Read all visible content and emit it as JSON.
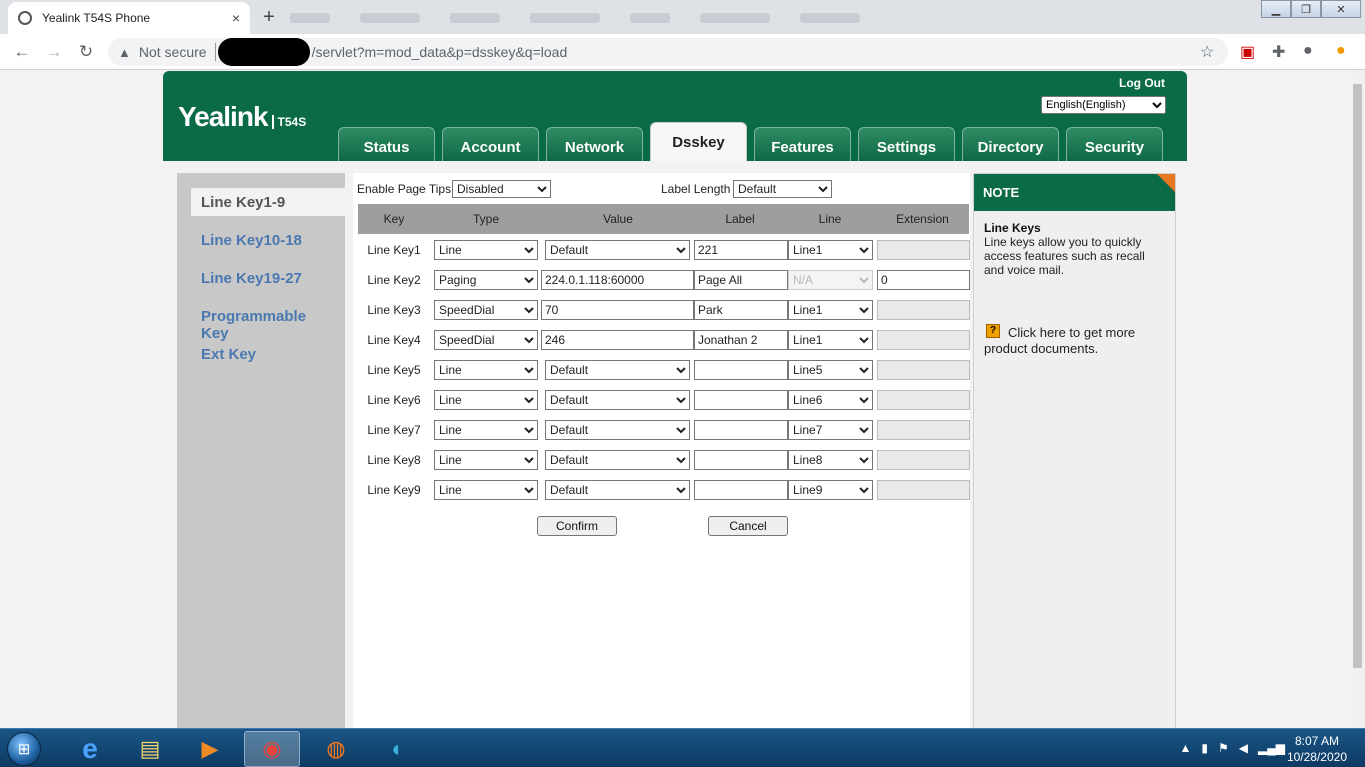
{
  "browser": {
    "tab_title": "Yealink T54S Phone",
    "tab_close": "×",
    "new_tab": "+",
    "security_label": "Not secure",
    "url_path": "/servlet?m=mod_data&p=dsskey&q=load"
  },
  "header": {
    "brand": "Yealink",
    "model": "T54S",
    "logout": "Log Out",
    "language": "English(English)",
    "nav_tabs": [
      "Status",
      "Account",
      "Network",
      "Dsskey",
      "Features",
      "Settings",
      "Directory",
      "Security"
    ],
    "active_tab": "Dsskey"
  },
  "sidebar": {
    "items": [
      "Line Key1-9",
      "Line Key10-18",
      "Line Key19-27",
      "Programmable Key",
      "Ext Key"
    ],
    "active": "Line Key1-9"
  },
  "controls": {
    "page_tips_label": "Enable Page Tips",
    "page_tips_value": "Disabled",
    "label_length_label": "Label Length",
    "label_length_value": "Default"
  },
  "table": {
    "headers": [
      "Key",
      "Type",
      "Value",
      "Label",
      "Line",
      "Extension"
    ],
    "rows": [
      {
        "key": "Line Key1",
        "type": "Line",
        "value": "Default",
        "value_kind": "select",
        "label": "221",
        "line": "Line1",
        "line_disabled": false,
        "extension": "",
        "ext_disabled": true
      },
      {
        "key": "Line Key2",
        "type": "Paging",
        "value": "224.0.1.118:60000",
        "value_kind": "text",
        "label": "Page All",
        "line": "N/A",
        "line_disabled": true,
        "extension": "0",
        "ext_disabled": false
      },
      {
        "key": "Line Key3",
        "type": "SpeedDial",
        "value": "70",
        "value_kind": "text",
        "label": "Park",
        "line": "Line1",
        "line_disabled": false,
        "extension": "",
        "ext_disabled": true
      },
      {
        "key": "Line Key4",
        "type": "SpeedDial",
        "value": "246",
        "value_kind": "text",
        "label": "Jonathan 2",
        "line": "Line1",
        "line_disabled": false,
        "extension": "",
        "ext_disabled": true
      },
      {
        "key": "Line Key5",
        "type": "Line",
        "value": "Default",
        "value_kind": "select",
        "label": "",
        "line": "Line5",
        "line_disabled": false,
        "extension": "",
        "ext_disabled": true
      },
      {
        "key": "Line Key6",
        "type": "Line",
        "value": "Default",
        "value_kind": "select",
        "label": "",
        "line": "Line6",
        "line_disabled": false,
        "extension": "",
        "ext_disabled": true
      },
      {
        "key": "Line Key7",
        "type": "Line",
        "value": "Default",
        "value_kind": "select",
        "label": "",
        "line": "Line7",
        "line_disabled": false,
        "extension": "",
        "ext_disabled": true
      },
      {
        "key": "Line Key8",
        "type": "Line",
        "value": "Default",
        "value_kind": "select",
        "label": "",
        "line": "Line8",
        "line_disabled": false,
        "extension": "",
        "ext_disabled": true
      },
      {
        "key": "Line Key9",
        "type": "Line",
        "value": "Default",
        "value_kind": "select",
        "label": "",
        "line": "Line9",
        "line_disabled": false,
        "extension": "",
        "ext_disabled": true
      }
    ]
  },
  "buttons": {
    "confirm": "Confirm",
    "cancel": "Cancel"
  },
  "note": {
    "heading": "NOTE",
    "title": "Line Keys",
    "body": "Line keys allow you to quickly access features such as recall and voice mail.",
    "help_icon": "?",
    "link": "Click here to get more product documents."
  },
  "taskbar": {
    "time": "8:07 AM",
    "date": "10/28/2020",
    "apps": [
      "internet-explorer-icon",
      "file-explorer-icon",
      "media-player-icon",
      "chrome-icon",
      "firefox-icon",
      "edge-icon"
    ]
  },
  "colors": {
    "brand_green": "#0b6b47",
    "note_corner": "#e87722",
    "sidebar_link": "#4a78b0"
  }
}
